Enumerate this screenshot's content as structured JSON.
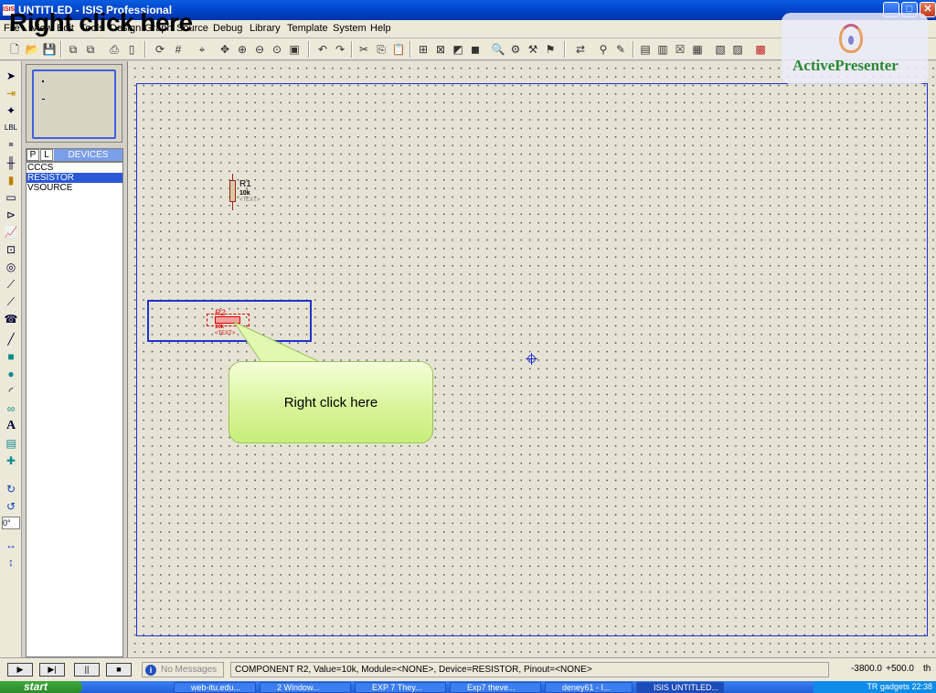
{
  "window": {
    "title": "UNTITLED - ISIS Professional",
    "app_icon": "ISIS",
    "buttons": {
      "minimize": "_",
      "maximize": "□",
      "close": "✕"
    }
  },
  "overlay": {
    "title": "Right click here"
  },
  "menu": {
    "items": [
      "File",
      "View",
      "Edit",
      "Tools",
      "Design",
      "Graph",
      "Source",
      "Debug",
      "Library",
      "Template",
      "System",
      "Help"
    ]
  },
  "toolbar": {
    "icons": [
      "new-icon",
      "open-icon",
      "save-icon",
      "import-icon",
      "export-icon",
      "print-icon",
      "page-icon",
      "refresh-icon",
      "grid-icon",
      "origin-icon",
      "pan-icon",
      "zoom-in-icon",
      "zoom-out-icon",
      "zoom-all-icon",
      "zoom-area-icon",
      "undo-icon",
      "redo-icon",
      "cut-icon",
      "copy-icon",
      "paste-icon",
      "block-copy-icon",
      "block-move-icon",
      "block-rotate-icon",
      "block-delete-icon",
      "pick-icon",
      "make-device-icon",
      "packaging-icon",
      "decompose-icon",
      "wire-autorouter-icon",
      "search-icon",
      "property-icon",
      "new-sheet-icon",
      "remove-sheet-icon",
      "exit-sheet-icon",
      "bom-icon",
      "netlist-icon",
      "ares-icon"
    ]
  },
  "left_toolbar": {
    "icons": [
      "selection-icon",
      "component-icon",
      "junction-icon",
      "wire-label-icon",
      "text-script-icon",
      "bus-icon",
      "subcircuit-icon",
      "terminal-icon",
      "pin-icon",
      "graph-icon",
      "tape-icon",
      "generator-icon",
      "voltage-probe-icon",
      "current-probe-icon",
      "virtual-instrument-icon",
      "line-icon",
      "box-icon",
      "circle-icon",
      "arc-icon",
      "path-icon",
      "text-icon",
      "symbol-icon",
      "marker-icon",
      "rotate-cw-icon",
      "rotate-ccw-icon",
      "mirror-x-icon",
      "mirror-y-icon"
    ],
    "angle": "0°"
  },
  "panel": {
    "tabs": {
      "p": "P",
      "l": "L"
    },
    "header": "DEVICES",
    "devices": [
      {
        "name": "CCCS",
        "selected": false
      },
      {
        "name": "RESISTOR",
        "selected": true
      },
      {
        "name": "VSOURCE",
        "selected": false
      }
    ]
  },
  "canvas": {
    "placed": {
      "ref": "R1",
      "value": "10k",
      "text": "<TEXT>"
    },
    "ghost": {
      "ref": "R2",
      "value": "10k",
      "text": "<TEXT>"
    },
    "callout": "Right click here"
  },
  "watermark": {
    "text": "ActivePresenter"
  },
  "status": {
    "sim_buttons": [
      "▶",
      "▶|",
      "||",
      "■"
    ],
    "messages": "No Messages",
    "text": "COMPONENT R2, Value=10k, Module=<NONE>, Device=RESISTOR, Pinout=<NONE>",
    "x": "-3800.0",
    "y": "+500.0",
    "unit": "th"
  },
  "taskbar": {
    "start": "start",
    "tasks": [
      "web-itu.edu...",
      "2 Window...",
      "EXP 7 They...",
      "Exp7 theve...",
      "deney61 - I...",
      "ISIS UNTITLED..."
    ],
    "tray": "TR  gadgets  22:38"
  }
}
